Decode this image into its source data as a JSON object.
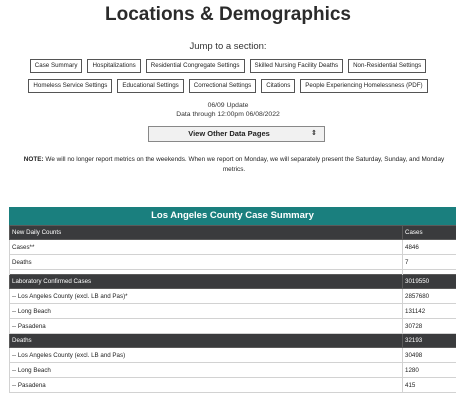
{
  "page": {
    "title": "Locations & Demographics",
    "jump_label": "Jump to a section:"
  },
  "jump_links_row1": [
    "Case Summary",
    "Hospitalizations",
    "Residential Congregate Settings",
    "Skilled Nursing Facility Deaths",
    "Non-Residential Settings"
  ],
  "jump_links_row2": [
    "Homeless Service Settings",
    "Educational Settings",
    "Correctional Settings",
    "Citations",
    "People Experiencing Homelessness (PDF)"
  ],
  "update": {
    "line1": "06/09 Update",
    "line2": "Data through 12:00pm 06/08/2022"
  },
  "select": {
    "label": "View Other Data Pages",
    "arrows": "⇕"
  },
  "note": {
    "prefix": "NOTE:",
    "text": " We will no longer report metrics on the weekends. When we report on Monday, we will separately present the Saturday, Sunday, and Monday metrics."
  },
  "case_summary": {
    "title": "Los Angeles County Case Summary",
    "header1": [
      "New Daily Counts",
      "Cases"
    ],
    "rows1": [
      [
        "Cases**",
        "4846"
      ],
      [
        "Deaths",
        "7"
      ]
    ],
    "header2": [
      "Laboratory Confirmed Cases",
      "3019550"
    ],
    "rows2": [
      [
        "-- Los Angeles County (excl. LB and Pas)*",
        "2857680"
      ],
      [
        "-- Long Beach",
        "131142"
      ],
      [
        "-- Pasadena",
        "30728"
      ]
    ],
    "header3": [
      "Deaths",
      "32193"
    ],
    "rows3": [
      [
        "-- Los Angeles County (excl. LB and Pas)",
        "30498"
      ],
      [
        "-- Long Beach",
        "1280"
      ],
      [
        "-- Pasadena",
        "415"
      ]
    ]
  }
}
